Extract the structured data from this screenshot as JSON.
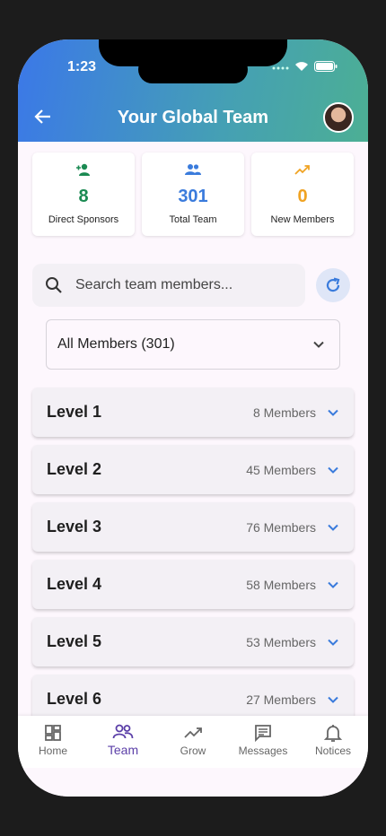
{
  "status_bar": {
    "time": "1:23"
  },
  "header": {
    "title": "Your Global Team"
  },
  "stats": [
    {
      "icon": "person-add-icon",
      "value": "8",
      "label": "Direct Sponsors",
      "color": "#1a8a52"
    },
    {
      "icon": "group-icon",
      "value": "301",
      "label": "Total Team",
      "color": "#3a7bdc"
    },
    {
      "icon": "trending-up-icon",
      "value": "0",
      "label": "New Members",
      "color": "#f0a323"
    }
  ],
  "search": {
    "placeholder": "Search team members..."
  },
  "filter": {
    "selected": "All Members (301)"
  },
  "levels": [
    {
      "name": "Level 1",
      "count": "8 Members"
    },
    {
      "name": "Level 2",
      "count": "45 Members"
    },
    {
      "name": "Level 3",
      "count": "76 Members"
    },
    {
      "name": "Level 4",
      "count": "58 Members"
    },
    {
      "name": "Level 5",
      "count": "53 Members"
    },
    {
      "name": "Level 6",
      "count": "27 Members"
    }
  ],
  "nav": [
    {
      "label": "Home",
      "icon": "dashboard-icon"
    },
    {
      "label": "Team",
      "icon": "people-icon",
      "active": true
    },
    {
      "label": "Grow",
      "icon": "trending-up-icon"
    },
    {
      "label": "Messages",
      "icon": "message-icon"
    },
    {
      "label": "Notices",
      "icon": "bell-icon"
    }
  ],
  "colors": {
    "accent": "#3a7bdc",
    "active_nav": "#5b3fa8"
  }
}
